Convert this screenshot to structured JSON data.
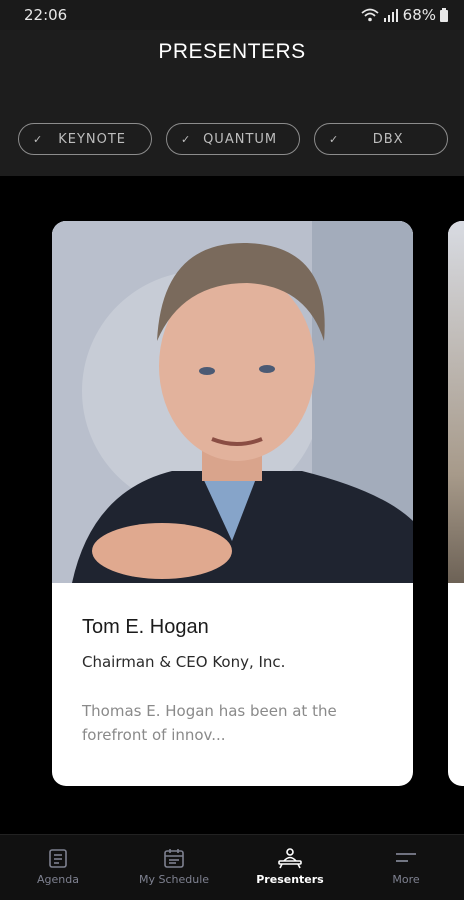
{
  "status_bar": {
    "time": "22:06",
    "battery": "68%"
  },
  "header": {
    "title": "PRESENTERS"
  },
  "filters": [
    {
      "label": "KEYNOTE"
    },
    {
      "label": "QUANTUM"
    },
    {
      "label": "DBX"
    }
  ],
  "presenter": {
    "name": "Tom E. Hogan",
    "role": "Chairman & CEO Kony, Inc.",
    "bio": "Thomas E. Hogan has been at the forefront of innov..."
  },
  "tabs": [
    {
      "label": "Agenda",
      "icon": "agenda-icon"
    },
    {
      "label": "My Schedule",
      "icon": "calendar-icon"
    },
    {
      "label": "Presenters",
      "icon": "presenter-icon"
    },
    {
      "label": "More",
      "icon": "menu-icon"
    }
  ],
  "colors": {
    "background": "#000000",
    "header": "#1d1d1d",
    "card": "#ffffff",
    "tab_inactive": "#7e8190",
    "tab_active": "#ffffff"
  }
}
